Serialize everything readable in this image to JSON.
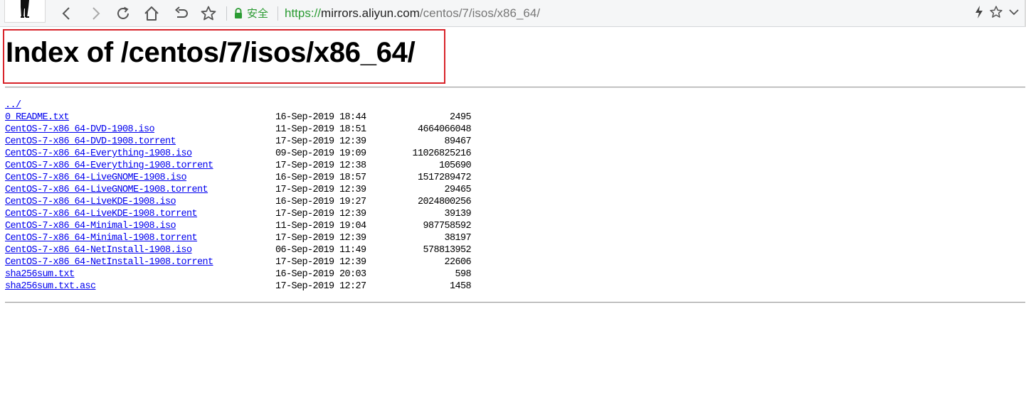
{
  "browser": {
    "secure_label": "安全",
    "url": {
      "scheme": "https://",
      "host": "mirrors.aliyun.com",
      "path": "/centos/7/isos/x86_64/"
    },
    "colors": {
      "secure_green": "#2a9b32",
      "highlight_red": "#d8232a",
      "link_blue": "#0000ee"
    }
  },
  "page": {
    "title": "Index of /centos/7/isos/x86_64/",
    "parent_link": "../",
    "entries": [
      {
        "name": "0_README.txt",
        "date": "16-Sep-2019 18:44",
        "size": "2495"
      },
      {
        "name": "CentOS-7-x86_64-DVD-1908.iso",
        "date": "11-Sep-2019 18:51",
        "size": "4664066048"
      },
      {
        "name": "CentOS-7-x86_64-DVD-1908.torrent",
        "date": "17-Sep-2019 12:39",
        "size": "89467"
      },
      {
        "name": "CentOS-7-x86_64-Everything-1908.iso",
        "date": "09-Sep-2019 19:09",
        "size": "11026825216"
      },
      {
        "name": "CentOS-7-x86_64-Everything-1908.torrent",
        "date": "17-Sep-2019 12:38",
        "size": "105690"
      },
      {
        "name": "CentOS-7-x86_64-LiveGNOME-1908.iso",
        "date": "16-Sep-2019 18:57",
        "size": "1517289472"
      },
      {
        "name": "CentOS-7-x86_64-LiveGNOME-1908.torrent",
        "date": "17-Sep-2019 12:39",
        "size": "29465"
      },
      {
        "name": "CentOS-7-x86_64-LiveKDE-1908.iso",
        "date": "16-Sep-2019 19:27",
        "size": "2024800256"
      },
      {
        "name": "CentOS-7-x86_64-LiveKDE-1908.torrent",
        "date": "17-Sep-2019 12:39",
        "size": "39139"
      },
      {
        "name": "CentOS-7-x86_64-Minimal-1908.iso",
        "date": "11-Sep-2019 19:04",
        "size": "987758592"
      },
      {
        "name": "CentOS-7-x86_64-Minimal-1908.torrent",
        "date": "17-Sep-2019 12:39",
        "size": "38197"
      },
      {
        "name": "CentOS-7-x86_64-NetInstall-1908.iso",
        "date": "06-Sep-2019 11:49",
        "size": "578813952"
      },
      {
        "name": "CentOS-7-x86_64-NetInstall-1908.torrent",
        "date": "17-Sep-2019 12:39",
        "size": "22606"
      },
      {
        "name": "sha256sum.txt",
        "date": "16-Sep-2019 20:03",
        "size": "598"
      },
      {
        "name": "sha256sum.txt.asc",
        "date": "17-Sep-2019 12:27",
        "size": "1458"
      }
    ]
  }
}
